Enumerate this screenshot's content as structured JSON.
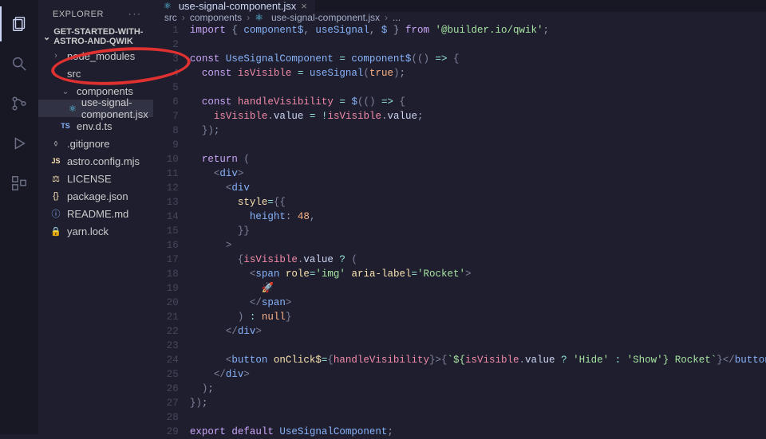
{
  "sidebar": {
    "title": "EXPLORER",
    "project": "GET-STARTED-WITH-ASTRO-AND-QWIK",
    "items": [
      {
        "label": "node_modules",
        "icon": "chevron-right",
        "indent": 0,
        "type": "folder",
        "selected": false
      },
      {
        "label": "src",
        "icon": "chevron-down",
        "indent": 0,
        "type": "folder",
        "selected": false
      },
      {
        "label": "components",
        "icon": "chevron-down",
        "indent": 1,
        "type": "folder",
        "selected": false
      },
      {
        "label": "use-signal-component.jsx",
        "icon": "react",
        "indent": 2,
        "type": "file",
        "selected": true
      },
      {
        "label": "env.d.ts",
        "icon": "ts",
        "indent": 1,
        "type": "file",
        "selected": false
      },
      {
        "label": ".gitignore",
        "icon": "generic",
        "indent": 0,
        "type": "file",
        "selected": false
      },
      {
        "label": "astro.config.mjs",
        "icon": "js",
        "indent": 0,
        "type": "file",
        "selected": false
      },
      {
        "label": "LICENSE",
        "icon": "license",
        "indent": 0,
        "type": "file",
        "selected": false
      },
      {
        "label": "package.json",
        "icon": "json",
        "indent": 0,
        "type": "file",
        "selected": false
      },
      {
        "label": "README.md",
        "icon": "info",
        "indent": 0,
        "type": "file",
        "selected": false
      },
      {
        "label": "yarn.lock",
        "icon": "lock",
        "indent": 0,
        "type": "file",
        "selected": false
      }
    ]
  },
  "tabs": [
    {
      "label": "use-signal-component.jsx",
      "icon": "react",
      "active": true
    }
  ],
  "breadcrumbs": [
    "src",
    "components",
    "use-signal-component.jsx",
    "..."
  ],
  "code": [
    [
      [
        "kw",
        "import"
      ],
      [
        "punc",
        " { "
      ],
      [
        "fn",
        "component$"
      ],
      [
        "punc",
        ", "
      ],
      [
        "fn",
        "useSignal"
      ],
      [
        "punc",
        ", "
      ],
      [
        "fn",
        "$"
      ],
      [
        "punc",
        " } "
      ],
      [
        "kw",
        "from"
      ],
      [
        "punc",
        " "
      ],
      [
        "str",
        "'@builder.io/qwik'"
      ],
      [
        "punc",
        ";"
      ]
    ],
    [],
    [
      [
        "kw",
        "const"
      ],
      [
        "punc",
        " "
      ],
      [
        "fn",
        "UseSignalComponent"
      ],
      [
        "punc",
        " "
      ],
      [
        "op",
        "="
      ],
      [
        "punc",
        " "
      ],
      [
        "fn",
        "component$"
      ],
      [
        "dim",
        "("
      ],
      [
        "dim",
        "()"
      ],
      [
        "punc",
        " "
      ],
      [
        "op",
        "=>"
      ],
      [
        "punc",
        " "
      ],
      [
        "dim",
        "{"
      ]
    ],
    [
      [
        "punc",
        "  "
      ],
      [
        "kw",
        "const"
      ],
      [
        "punc",
        " "
      ],
      [
        "var",
        "isVisible"
      ],
      [
        "punc",
        " "
      ],
      [
        "op",
        "="
      ],
      [
        "punc",
        " "
      ],
      [
        "fn",
        "useSignal"
      ],
      [
        "dim",
        "("
      ],
      [
        "bool",
        "true"
      ],
      [
        "dim",
        ")"
      ],
      [
        "punc",
        ";"
      ]
    ],
    [],
    [
      [
        "punc",
        "  "
      ],
      [
        "kw",
        "const"
      ],
      [
        "punc",
        " "
      ],
      [
        "var",
        "handleVisibility"
      ],
      [
        "punc",
        " "
      ],
      [
        "op",
        "="
      ],
      [
        "punc",
        " "
      ],
      [
        "fn",
        "$"
      ],
      [
        "dim",
        "("
      ],
      [
        "dim",
        "()"
      ],
      [
        "punc",
        " "
      ],
      [
        "op",
        "=>"
      ],
      [
        "punc",
        " "
      ],
      [
        "dim",
        "{"
      ]
    ],
    [
      [
        "punc",
        "    "
      ],
      [
        "var",
        "isVisible"
      ],
      [
        "punc",
        "."
      ],
      [
        "member",
        "value"
      ],
      [
        "punc",
        " "
      ],
      [
        "op",
        "="
      ],
      [
        "punc",
        " "
      ],
      [
        "op",
        "!"
      ],
      [
        "var",
        "isVisible"
      ],
      [
        "punc",
        "."
      ],
      [
        "member",
        "value"
      ],
      [
        "punc",
        ";"
      ]
    ],
    [
      [
        "punc",
        "  "
      ],
      [
        "dim",
        "})"
      ],
      [
        "punc",
        ";"
      ]
    ],
    [],
    [
      [
        "punc",
        "  "
      ],
      [
        "kw",
        "return"
      ],
      [
        "punc",
        " "
      ],
      [
        "dim",
        "("
      ]
    ],
    [
      [
        "punc",
        "    "
      ],
      [
        "dim",
        "<"
      ],
      [
        "tag",
        "div"
      ],
      [
        "dim",
        ">"
      ]
    ],
    [
      [
        "punc",
        "      "
      ],
      [
        "dim",
        "<"
      ],
      [
        "tag",
        "div"
      ]
    ],
    [
      [
        "punc",
        "        "
      ],
      [
        "attr",
        "style"
      ],
      [
        "op",
        "="
      ],
      [
        "dim",
        "{{"
      ]
    ],
    [
      [
        "punc",
        "          "
      ],
      [
        "key",
        "height"
      ],
      [
        "punc",
        ": "
      ],
      [
        "num",
        "48"
      ],
      [
        "punc",
        ","
      ]
    ],
    [
      [
        "punc",
        "        "
      ],
      [
        "dim",
        "}}"
      ]
    ],
    [
      [
        "punc",
        "      "
      ],
      [
        "dim",
        ">"
      ]
    ],
    [
      [
        "punc",
        "        "
      ],
      [
        "dim",
        "{"
      ],
      [
        "var",
        "isVisible"
      ],
      [
        "punc",
        "."
      ],
      [
        "member",
        "value"
      ],
      [
        "punc",
        " "
      ],
      [
        "op",
        "?"
      ],
      [
        "punc",
        " "
      ],
      [
        "dim",
        "("
      ]
    ],
    [
      [
        "punc",
        "          "
      ],
      [
        "dim",
        "<"
      ],
      [
        "tag",
        "span"
      ],
      [
        "punc",
        " "
      ],
      [
        "attr",
        "role"
      ],
      [
        "op",
        "="
      ],
      [
        "str",
        "'img'"
      ],
      [
        "punc",
        " "
      ],
      [
        "attr",
        "aria-label"
      ],
      [
        "op",
        "="
      ],
      [
        "str",
        "'Rocket'"
      ],
      [
        "dim",
        ">"
      ]
    ],
    [
      [
        "punc",
        "            "
      ],
      [
        "prop",
        "🚀"
      ]
    ],
    [
      [
        "punc",
        "          "
      ],
      [
        "dim",
        "</"
      ],
      [
        "tag",
        "span"
      ],
      [
        "dim",
        ">"
      ]
    ],
    [
      [
        "punc",
        "        "
      ],
      [
        "dim",
        ")"
      ],
      [
        "punc",
        " "
      ],
      [
        "op",
        ":"
      ],
      [
        "punc",
        " "
      ],
      [
        "bool",
        "null"
      ],
      [
        "dim",
        "}"
      ]
    ],
    [
      [
        "punc",
        "      "
      ],
      [
        "dim",
        "</"
      ],
      [
        "tag",
        "div"
      ],
      [
        "dim",
        ">"
      ]
    ],
    [],
    [
      [
        "punc",
        "      "
      ],
      [
        "dim",
        "<"
      ],
      [
        "tag",
        "button"
      ],
      [
        "punc",
        " "
      ],
      [
        "attr",
        "onClick$"
      ],
      [
        "op",
        "="
      ],
      [
        "dim",
        "{"
      ],
      [
        "var",
        "handleVisibility"
      ],
      [
        "dim",
        "}"
      ],
      [
        "dim",
        ">"
      ],
      [
        "dim",
        "{"
      ],
      [
        "str",
        "`${"
      ],
      [
        "var",
        "isVisible"
      ],
      [
        "punc",
        "."
      ],
      [
        "member",
        "value"
      ],
      [
        "punc",
        " "
      ],
      [
        "op",
        "?"
      ],
      [
        "punc",
        " "
      ],
      [
        "str",
        "'Hide'"
      ],
      [
        "punc",
        " "
      ],
      [
        "op",
        ":"
      ],
      [
        "punc",
        " "
      ],
      [
        "str",
        "'Show'"
      ],
      [
        "str",
        "} Rocket`"
      ],
      [
        "dim",
        "}"
      ],
      [
        "dim",
        "</"
      ],
      [
        "tag",
        "button"
      ],
      [
        "dim",
        ">"
      ]
    ],
    [
      [
        "punc",
        "    "
      ],
      [
        "dim",
        "</"
      ],
      [
        "tag",
        "div"
      ],
      [
        "dim",
        ">"
      ]
    ],
    [
      [
        "punc",
        "  "
      ],
      [
        "dim",
        ")"
      ],
      [
        "punc",
        ";"
      ]
    ],
    [
      [
        "dim",
        "})"
      ],
      [
        "punc",
        ";"
      ]
    ],
    [],
    [
      [
        "kw",
        "export"
      ],
      [
        "punc",
        " "
      ],
      [
        "kw",
        "default"
      ],
      [
        "punc",
        " "
      ],
      [
        "fn",
        "UseSignalComponent"
      ],
      [
        "punc",
        ";"
      ]
    ]
  ]
}
